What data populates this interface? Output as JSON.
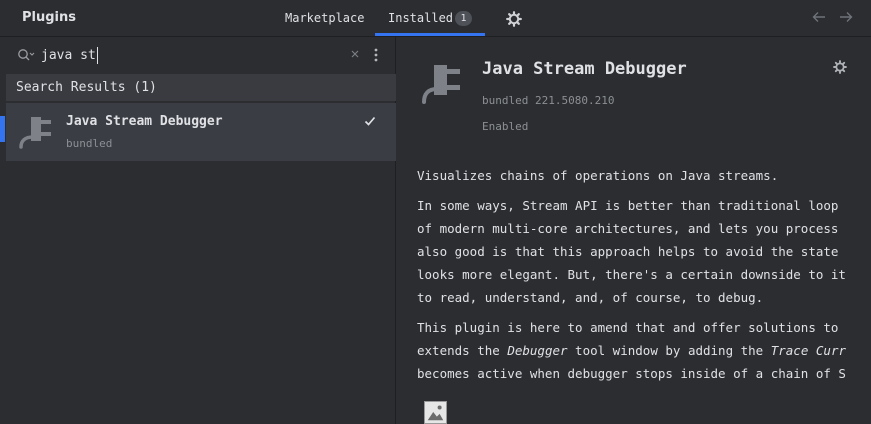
{
  "header": {
    "title": "Plugins",
    "tabs": [
      {
        "label": "Marketplace",
        "active": false
      },
      {
        "label": "Installed",
        "active": true,
        "badge": "1"
      }
    ],
    "icons": {
      "settings": "gear-icon",
      "back": "arrow-left-icon",
      "forward": "arrow-right-icon"
    }
  },
  "search": {
    "value": "java st",
    "icon": "search-icon",
    "clear_icon": "close-icon",
    "more_icon": "more-vertical-icon"
  },
  "results": {
    "header": "Search Results (1)",
    "items": [
      {
        "name": "Java Stream Debugger",
        "subtitle": "bundled",
        "checked": true,
        "icon": "plug-icon"
      }
    ]
  },
  "details": {
    "name": "Java Stream Debugger",
    "version": "bundled 221.5080.210",
    "status": "Enabled",
    "icon": "plug-icon",
    "description": {
      "p1": "Visualizes chains of operations on Java streams.",
      "p2_lines": [
        "In some ways, Stream API is better than traditional loop",
        "of modern multi-core architectures, and lets you process",
        "also good is that this approach helps to avoid the state",
        "looks more elegant. But, there's a certain downside to it",
        "to read, understand, and, of course, to debug."
      ],
      "p3_line1": "This plugin is here to amend that and offer solutions to",
      "p3_line2_a": "extends the ",
      "p3_line2_em1": "Debugger",
      "p3_line2_b": " tool window by adding the ",
      "p3_line2_em2": "Trace Curr",
      "p3_line3": "becomes active when debugger stops inside of a chain of S"
    }
  },
  "colors": {
    "accent": "#3574f0",
    "background": "#2b2d30",
    "selection": "#393b40",
    "muted_text": "#8c8f94"
  }
}
